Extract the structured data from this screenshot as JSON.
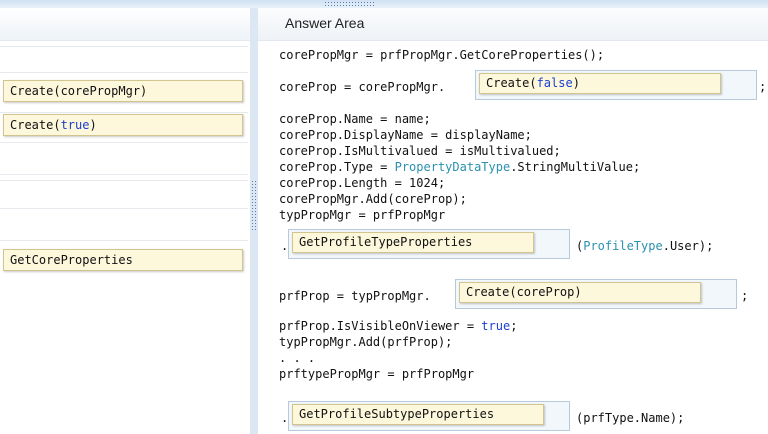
{
  "left_pane": {
    "items": [
      {
        "label": "Create(corePropMgr)"
      },
      {
        "label_pre": "Create(",
        "label_kw": "true",
        "label_post": ")"
      },
      {
        "label": "GetCoreProperties"
      }
    ]
  },
  "answer_area": {
    "title": "Answer Area",
    "lines": {
      "l1": "corePropMgr = prfPropMgr.GetCoreProperties();",
      "l2_pre": "coreProp = corePropMgr.",
      "l2_post": ";",
      "l3": "coreProp.Name = name;",
      "l4": "coreProp.DisplayName = displayName;",
      "l5": "coreProp.IsMultivalued = isMultivalued;",
      "l6_pre": "coreProp.Type = ",
      "l6_type": "PropertyDataType",
      "l6_post": ".StringMultiValue;",
      "l7": "coreProp.Length = 1024;",
      "l8": "corePropMgr.Add(coreProp);",
      "l9": "typPropMgr = prfPropMgr",
      "l10_pre": ".",
      "l10_open": "(",
      "l10_type": "ProfileType",
      "l10_post": ".User);",
      "l11_pre": "prfProp = typPropMgr.",
      "l11_post": ";",
      "l12_pre": "prfProp.IsVisibleOnViewer = ",
      "l12_kw": "true",
      "l12_post": ";",
      "l13": "typPropMgr.Add(prfProp);",
      "l14": ". . .",
      "l15": "prftypePropMgr = prfPropMgr",
      "l16_pre": ".",
      "l16_post": "(prfType.Name);"
    },
    "slots": {
      "s1_pre": "Create(",
      "s1_kw": "false",
      "s1_post": ")",
      "s2": "GetProfileTypeProperties",
      "s3": "Create(coreProp)",
      "s4": "GetProfileSubtypeProperties"
    }
  }
}
